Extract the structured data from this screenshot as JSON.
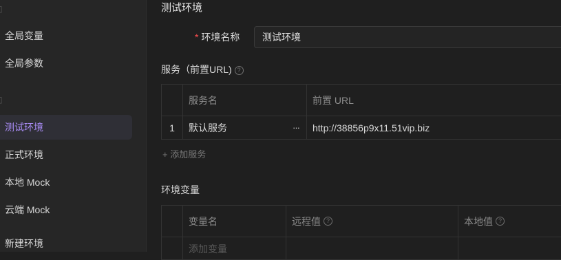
{
  "sidebar": {
    "items": [
      {
        "label": "全局变量"
      },
      {
        "label": "全局参数"
      },
      {
        "label": "测试环境"
      },
      {
        "label": "正式环境"
      },
      {
        "label": "本地 Mock"
      },
      {
        "label": "云端 Mock"
      },
      {
        "label": "新建环境"
      }
    ]
  },
  "page": {
    "title": "测试环境"
  },
  "form": {
    "env_name_label": "环境名称",
    "env_name_value": "测试环境"
  },
  "services": {
    "title": "服务（前置URL)",
    "columns": [
      "服务名",
      "前置 URL"
    ],
    "rows": [
      {
        "index": "1",
        "name": "默认服务",
        "url": "http://38856p9x11.51vip.biz"
      }
    ],
    "add_label": "+ 添加服务"
  },
  "env_vars": {
    "title": "环境变量",
    "columns": [
      "变量名",
      "远程值",
      "本地值"
    ],
    "add_placeholder": "添加变量"
  },
  "colors": {
    "accent": "#a98cf5",
    "required": "#ff4d4f"
  }
}
